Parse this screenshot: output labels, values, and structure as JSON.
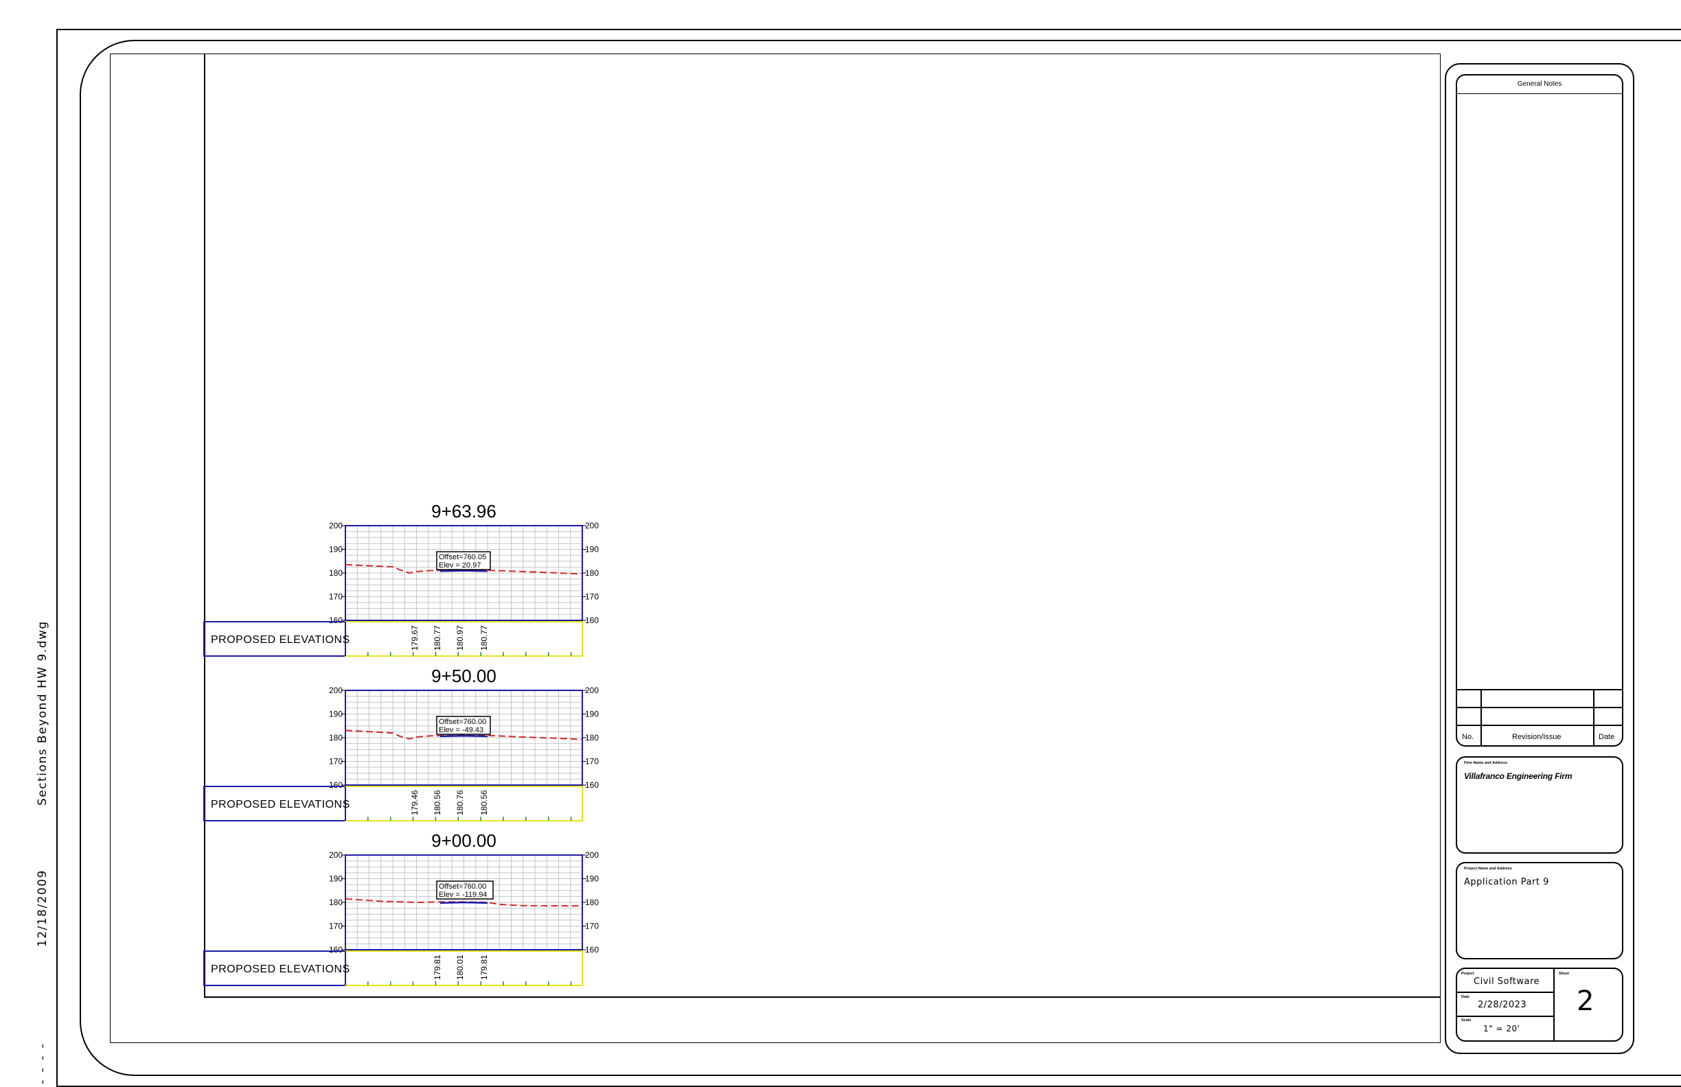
{
  "sidebar": {
    "filename": "Sections Beyond HW 9.dwg",
    "date": "12/18/2009",
    "dashes": "- - - -"
  },
  "title_block": {
    "notes_title": "General Notes",
    "rev_no_label": "No.",
    "rev_issue_label": "Revision/Issue",
    "rev_date_label": "Date",
    "firm_label": "Firm Name and Address",
    "firm_name": "Villafranco Engineering Firm",
    "project_label": "Project Name and Address",
    "project_name": "Application Part 9",
    "proj_label": "Project",
    "proj_value": "Civil Software",
    "sheet_label": "Sheet",
    "sheet_value": "2",
    "date_label": "Date",
    "date_value": "2/28/2023",
    "scale_label": "Scale",
    "scale_value": "1\" = 20'"
  },
  "colors": {
    "grid_border": "#1a1aa6",
    "grid_line": "#c4c4c4",
    "existing_ground": "#d42a2a",
    "proposed": "#1a1aa6",
    "table_frame": "#e6e619"
  },
  "chart_data": [
    {
      "type": "line",
      "title": "9+63.96",
      "ylim": [
        160,
        200
      ],
      "yticks": [
        160,
        170,
        180,
        190,
        200
      ],
      "grid": true,
      "annotation": [
        "Offset=760.05",
        "Elev = 20.97"
      ],
      "table_label": "PROPOSED ELEVATIONS",
      "elevations": [
        "179.67",
        "180.77",
        "180.97",
        "180.77"
      ],
      "series": [
        {
          "style": "existing-ground",
          "x": [
            0,
            0.2,
            0.23,
            0.27,
            0.3,
            0.36,
            0.5,
            0.64,
            0.7,
            1.0
          ],
          "y": [
            183.5,
            182.6,
            181.3,
            180.0,
            180.6,
            181.0,
            181.3,
            181.0,
            180.8,
            179.6
          ]
        },
        {
          "style": "proposed",
          "x": [
            0.4,
            0.5,
            0.6
          ],
          "y": [
            180.8,
            181.0,
            180.8
          ]
        }
      ]
    },
    {
      "type": "line",
      "title": "9+50.00",
      "ylim": [
        160,
        200
      ],
      "yticks": [
        160,
        170,
        180,
        190,
        200
      ],
      "grid": true,
      "annotation": [
        "Offset=760.00",
        "Elev = -49.43"
      ],
      "table_label": "PROPOSED ELEVATIONS",
      "elevations": [
        "179.46",
        "180.56",
        "180.76",
        "180.56"
      ],
      "series": [
        {
          "style": "existing-ground",
          "x": [
            0,
            0.2,
            0.23,
            0.27,
            0.3,
            0.36,
            0.5,
            0.64,
            0.7,
            1.0
          ],
          "y": [
            183.1,
            182.0,
            180.6,
            179.5,
            180.3,
            180.8,
            181.0,
            180.8,
            180.5,
            179.3
          ]
        },
        {
          "style": "proposed",
          "x": [
            0.4,
            0.5,
            0.6
          ],
          "y": [
            180.6,
            180.8,
            180.6
          ]
        }
      ]
    },
    {
      "type": "line",
      "title": "9+00.00",
      "ylim": [
        160,
        200
      ],
      "yticks": [
        160,
        170,
        180,
        190,
        200
      ],
      "grid": true,
      "annotation": [
        "Offset=760.00",
        "Elev = -119.94"
      ],
      "table_label": "PROPOSED ELEVATIONS",
      "elevations": [
        "179.81",
        "180.01",
        "179.81"
      ],
      "series": [
        {
          "style": "existing-ground",
          "x": [
            0,
            0.15,
            0.3,
            0.4,
            0.5,
            0.6,
            0.65,
            0.75,
            1.0
          ],
          "y": [
            181.5,
            180.5,
            180.0,
            180.2,
            180.2,
            180.0,
            179.2,
            178.6,
            178.5
          ]
        },
        {
          "style": "proposed",
          "x": [
            0.4,
            0.5,
            0.6
          ],
          "y": [
            179.8,
            180.0,
            179.8
          ]
        }
      ]
    }
  ]
}
